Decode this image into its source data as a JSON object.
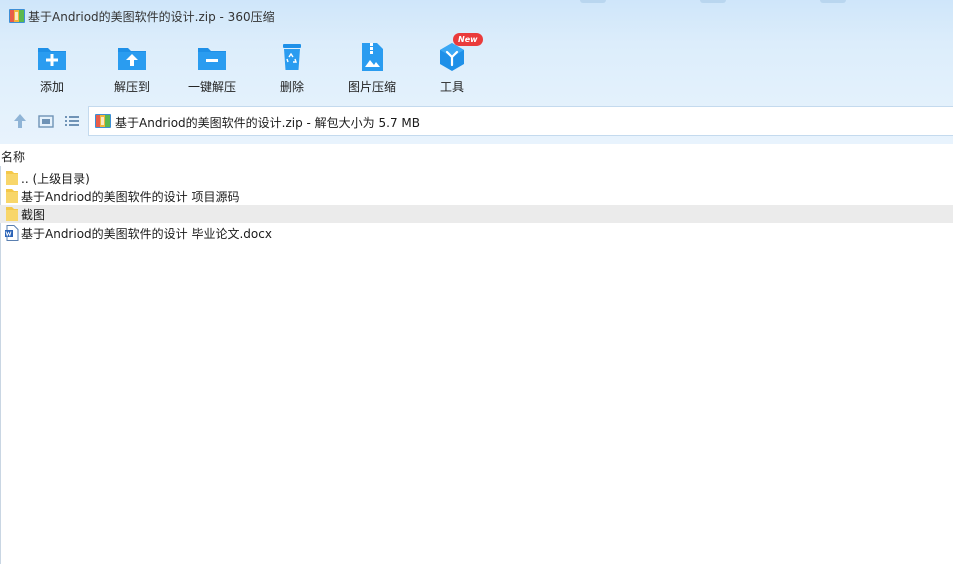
{
  "window": {
    "title": "基于Andriod的美图软件的设计.zip - 360压缩"
  },
  "toolbar": {
    "buttons": [
      {
        "label": "添加",
        "icon": "add-folder-icon"
      },
      {
        "label": "解压到",
        "icon": "extract-to-icon"
      },
      {
        "label": "一键解压",
        "icon": "one-click-extract-icon"
      },
      {
        "label": "删除",
        "icon": "recycle-bin-icon"
      },
      {
        "label": "图片压缩",
        "icon": "image-compress-icon"
      },
      {
        "label": "工具",
        "icon": "tools-cube-icon"
      }
    ],
    "new_badge": "New"
  },
  "nav": {
    "up_icon": "arrow-up-icon",
    "view_icon": "thumbnail-view-icon",
    "list_icon": "list-view-icon",
    "path": "基于Andriod的美图软件的设计.zip - 解包大小为 5.7 MB"
  },
  "list": {
    "column_name": "名称",
    "rows": [
      {
        "name": ".. (上级目录)",
        "icon": "folder-icon",
        "selected": false
      },
      {
        "name": "基于Andriod的美图软件的设计 项目源码",
        "icon": "folder-icon",
        "selected": false
      },
      {
        "name": "截图",
        "icon": "folder-icon",
        "selected": true
      },
      {
        "name": "基于Andriod的美图软件的设计 毕业论文.docx",
        "icon": "word-document-icon",
        "selected": false
      }
    ]
  },
  "colors": {
    "accent_blue": "#1e90e8",
    "toolbar_bg": "#dcedfb",
    "badge_red": "#ea3b3b",
    "folder_yellow": "#f4c84a",
    "selected_row": "#ebebeb"
  }
}
